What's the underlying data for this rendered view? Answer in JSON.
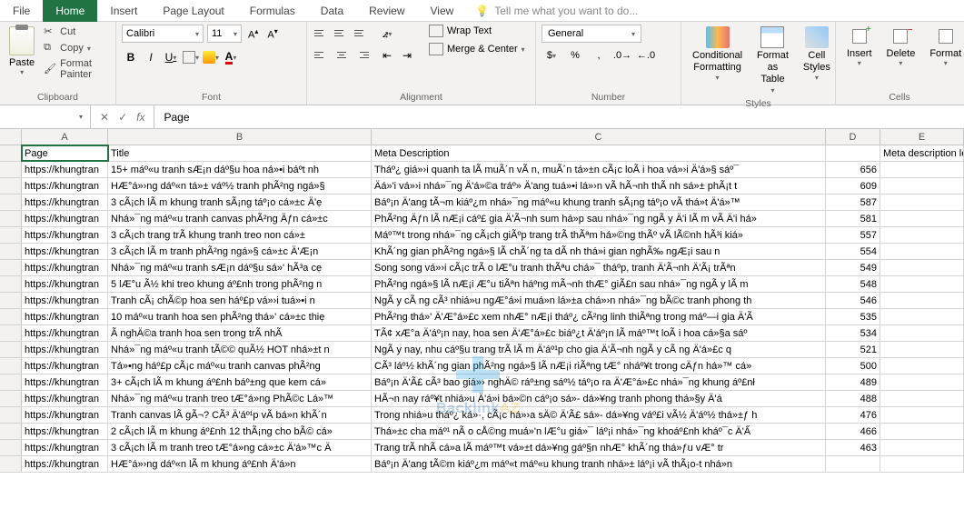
{
  "tabs": {
    "file": "File",
    "home": "Home",
    "insert": "Insert",
    "pagelayout": "Page Layout",
    "formulas": "Formulas",
    "data": "Data",
    "review": "Review",
    "view": "View"
  },
  "tellme": "Tell me what you want to do...",
  "ribbon": {
    "clipboard": {
      "paste": "Paste",
      "cut": "Cut",
      "copy": "Copy",
      "fp": "Format Painter",
      "label": "Clipboard"
    },
    "font": {
      "name": "Calibri",
      "size": "11",
      "label": "Font"
    },
    "alignment": {
      "wrap": "Wrap Text",
      "merge": "Merge & Center",
      "label": "Alignment"
    },
    "number": {
      "format": "General",
      "label": "Number"
    },
    "styles": {
      "cf": "Conditional Formatting",
      "ft": "Format as Table",
      "cs": "Cell Styles",
      "label": "Styles"
    },
    "cells": {
      "insert": "Insert",
      "delete": "Delete",
      "format": "Format",
      "label": "Cells"
    }
  },
  "formula_bar": {
    "namebox": "",
    "fx_value": "Page"
  },
  "columns": [
    "A",
    "B",
    "C",
    "D",
    "E"
  ],
  "headers": {
    "A": "Page",
    "B": "Title",
    "C": "Meta Description",
    "D": "",
    "E": "Meta description length"
  },
  "rows": [
    {
      "A": "https://khungtran",
      "B": "15+ máº«u tranh sÆ¡n dáº§u hoa ná»•i báº­t nh",
      "C": "Tháº¿ giá»›i quanh ta lÃ  muÃ´n vÃ n, muÃ´n tá»±n cÃ¡c loÃ i hoa vá»›i Ä'á»§ sáº¯",
      "D": "656",
      "E": ""
    },
    {
      "A": "https://khungtran",
      "B": "HÆ°á»›ng dáº«n tá»± váº½ tranh phÃ²ng ngá»§",
      "C": "Äá»'i vá»›i nhá»¯ng Ä'á»©a tráº» Ä'ang tuá»•i lá»›n vÃ  hÃ¬nh thÃ nh sá»± phÃ¡t t",
      "D": "609",
      "E": ""
    },
    {
      "A": "https://khungtran",
      "B": "3 cÃ¡ch lÃ m khung tranh sÃ¡ng táº¡o cá»±c Ä'ẹ",
      "C": "Báº¡n Ä'ang tÃ¬m kiáº¿m nhá»¯ng máº«u khung tranh sÃ¡ng táº¡o vÃ  thá»­t Ä'á»™",
      "D": "587",
      "E": ""
    },
    {
      "A": "https://khungtran",
      "B": "Nhá»¯ng máº«u tranh canvas phÃ²ng Äƒn cá»±c",
      "C": "PhÃ²ng Äƒn lÃ  nÆ¡i cáº£ gia Ä'Ã¬nh sum há»p sau nhá»¯ng ngÃ y Ä'i lÃ m vÃ  Ä'i há»",
      "D": "581",
      "E": ""
    },
    {
      "A": "https://khungtran",
      "B": "3 cÃ¡ch trang trÃ­ khung tranh treo non cá»±",
      "C": "Máº™t trong nhá»¯ng cÃ¡ch giÃºp trang trÃ­ thÃªm há»©ng thÃº vÃ  lÃ©nh hÃ³i kiá»",
      "D": "557",
      "E": ""
    },
    {
      "A": "https://khungtran",
      "B": "3 cÃ¡ch lÃ m tranh phÃ²ng ngá»§ cá»±c Ä'Æ¡n",
      "C": "KhÃ´ng gian phÃ²ng ngá»§ lÃ  chÃ´ng ta dÃ nh thá»i gian nghÃ‰ ngÆ¡i sau n",
      "D": "554",
      "E": ""
    },
    {
      "A": "https://khungtran",
      "B": "Nhá»¯ng máº«u tranh sÆ¡n dáº§u sá»' hÃ³a cẹ",
      "C": "Song song vá»›i cÃ¡c trÃ o lÆ°u tranh thÃªu chá»¯ tháº­p, tranh Ä'Ã¬nh Ä'Ã¡ trÃªn",
      "D": "549",
      "E": ""
    },
    {
      "A": "https://khungtran",
      "B": "5 lÆ°u Ã½ khi treo khung áº£nh trong phÃ²ng n",
      "C": "PhÃ²ng ngá»§ lÃ  nÆ¡i Æ°u tiÃªn háº­ng mÃ¬nh thÆ° giÃ£n sau nhá»¯ng ngÃ y lÃ m",
      "D": "548",
      "E": ""
    },
    {
      "A": "https://khungtran",
      "B": "Tranh cÃ¡ chÃ©p hoa sen háº£p vá»›i tuá»•i n",
      "C": "NgÃ y cÃ ng cÃ³ nhiá»u ngÆ°á»i muá»n lá»±a chá»›n nhá»¯ng bÃ©c tranh phong th",
      "D": "546",
      "E": ""
    },
    {
      "A": "https://khungtran",
      "B": "10 máº«u tranh hoa sen phÃ²ng thá»' cá»±c thiẹ",
      "C": "PhÃ²ng thá»' Ä'Æ°á»£c xem nhÆ° nÆ¡i tháº¿ cÃ²ng linh thiÃªng trong máº—i gia Ä'Ã",
      "D": "535",
      "E": ""
    },
    {
      "A": "https://khungtran",
      "B": "Ã nghÄ©a tranh hoa sen trong trÃ­ nhÃ",
      "C": "TÃ¢ xÆ°a Ä'áº¡n nay, hoa sen Ä'Æ°á»£c biáº¿t Ä'áº¡n lÃ  máº™t loÃ i hoa cá»§a sáº",
      "D": "534",
      "E": ""
    },
    {
      "A": "https://khungtran",
      "B": "Nhá»¯ng máº«u tranh tÃ©© quÃ½ HOT nhá»±t n",
      "C": "NgÃ y nay, nhu cáº§u trang trÃ­ lÃ m Ä'áº¹p cho gia Ä'Ã¬nh ngÃ y cÃ ng Ä'á»£c q",
      "D": "521",
      "E": ""
    },
    {
      "A": "https://khungtran",
      "B": "Tá»•ng háº£p cÃ¡c máº«u tranh canvas phÃ²ng",
      "C": "CÃ³ láº½ khÃ´ng gian phÃ²ng ngá»§ lÃ  nÆ¡i riÃªng tÆ° nháº¥t trong cÄƒn há»™ cá»",
      "D": "500",
      "E": ""
    },
    {
      "A": "https://khungtran",
      "B": "3+ cÃ¡ch lÃ m khung áº£nh báº±ng que kem cá»",
      "C": "Báº¡n Ä'Ã£ cÃ³ bao giá»› nghÄ© ráº±ng sáº½ táº¡o ra Ä'Æ°á»£c nhá»¯ng khung áº£nł",
      "D": "489",
      "E": ""
    },
    {
      "A": "https://khungtran",
      "B": "Nhá»¯ng máº«u tranh treo tÆ°á»ng PhÃ©c Lá»™",
      "C": "HÃ¬n nay ráº¥t nhiá»u Ä'á»i bá»©n cáº¡o sá»- dá»¥ng tranh phong thá»§y Ä'á",
      "D": "488",
      "E": ""
    },
    {
      "A": "https://khungtran",
      "B": "Tranh canvas lÃ  gÃ¬? CÃ³ Ä'áº¹p vÃ  bá»n khÃ´n",
      "C": "Trong nhiá»u tháº¿ ká»·, cÃ¡c há»›a sÄ© Ä'Ã£ sá»- dá»¥ng váº£i vÃ½ Ä'áº½ thá»±ƒ h",
      "D": "476",
      "E": ""
    },
    {
      "A": "https://khungtran",
      "B": "2 cÃ¡ch lÃ m khung áº£nh 12 thÃ¡ng cho bÃ© cá»",
      "C": "Thá»±c cha máº¹ nÃ o cÅ©ng muá»'n lÆ°u giá»¯ láº¡i nhá»¯ng khoáº£nh kháº¯c Ä'Ấ",
      "D": "466",
      "E": ""
    },
    {
      "A": "https://khungtran",
      "B": "3 cÃ¡ch lÃ m tranh treo tÆ°á»ng cá»±c Ä'á»™c Ä",
      "C": "Trang trÃ­ nhÃ cá»­a lÃ  máº™t vá»±t dá»¥ng gáº§n nhÆ° khÃ´ng thá»ƒu vÆ° tr",
      "D": "463",
      "E": ""
    },
    {
      "A": "https://khungtran",
      "B": "HÆ°á»›ng dáº«n lÃ m khung áº£nh Ä'á»n",
      "C": "Báº¡n Ä'ang tÃ©m kiáº¿m máº«t máº«u khung tranh nhá»± láº¡i vÃ  thÃ¡o-t nhá»n",
      "D": "",
      "E": ""
    }
  ],
  "watermark": {
    "text1": "Backlink",
    "text2": "AZ"
  }
}
